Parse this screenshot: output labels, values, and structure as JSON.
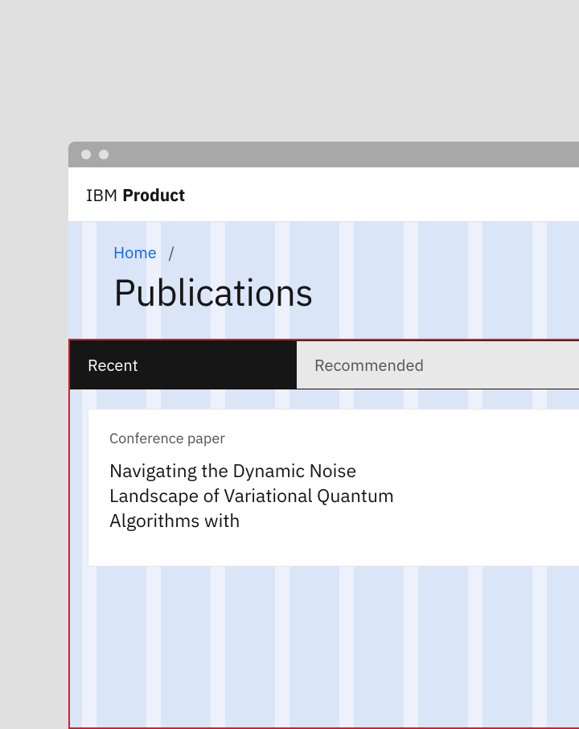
{
  "header": {
    "brand_light": "IBM",
    "brand_bold": "Product"
  },
  "breadcrumb": {
    "home": "Home",
    "separator": "/"
  },
  "page_title": "Publications",
  "tabs": {
    "recent": "Recent",
    "recommended": "Recommended"
  },
  "card": {
    "type": "Conference paper",
    "title": "Navigating the Dynamic Noise Landscape of Variational Quantum Algorithms with"
  }
}
